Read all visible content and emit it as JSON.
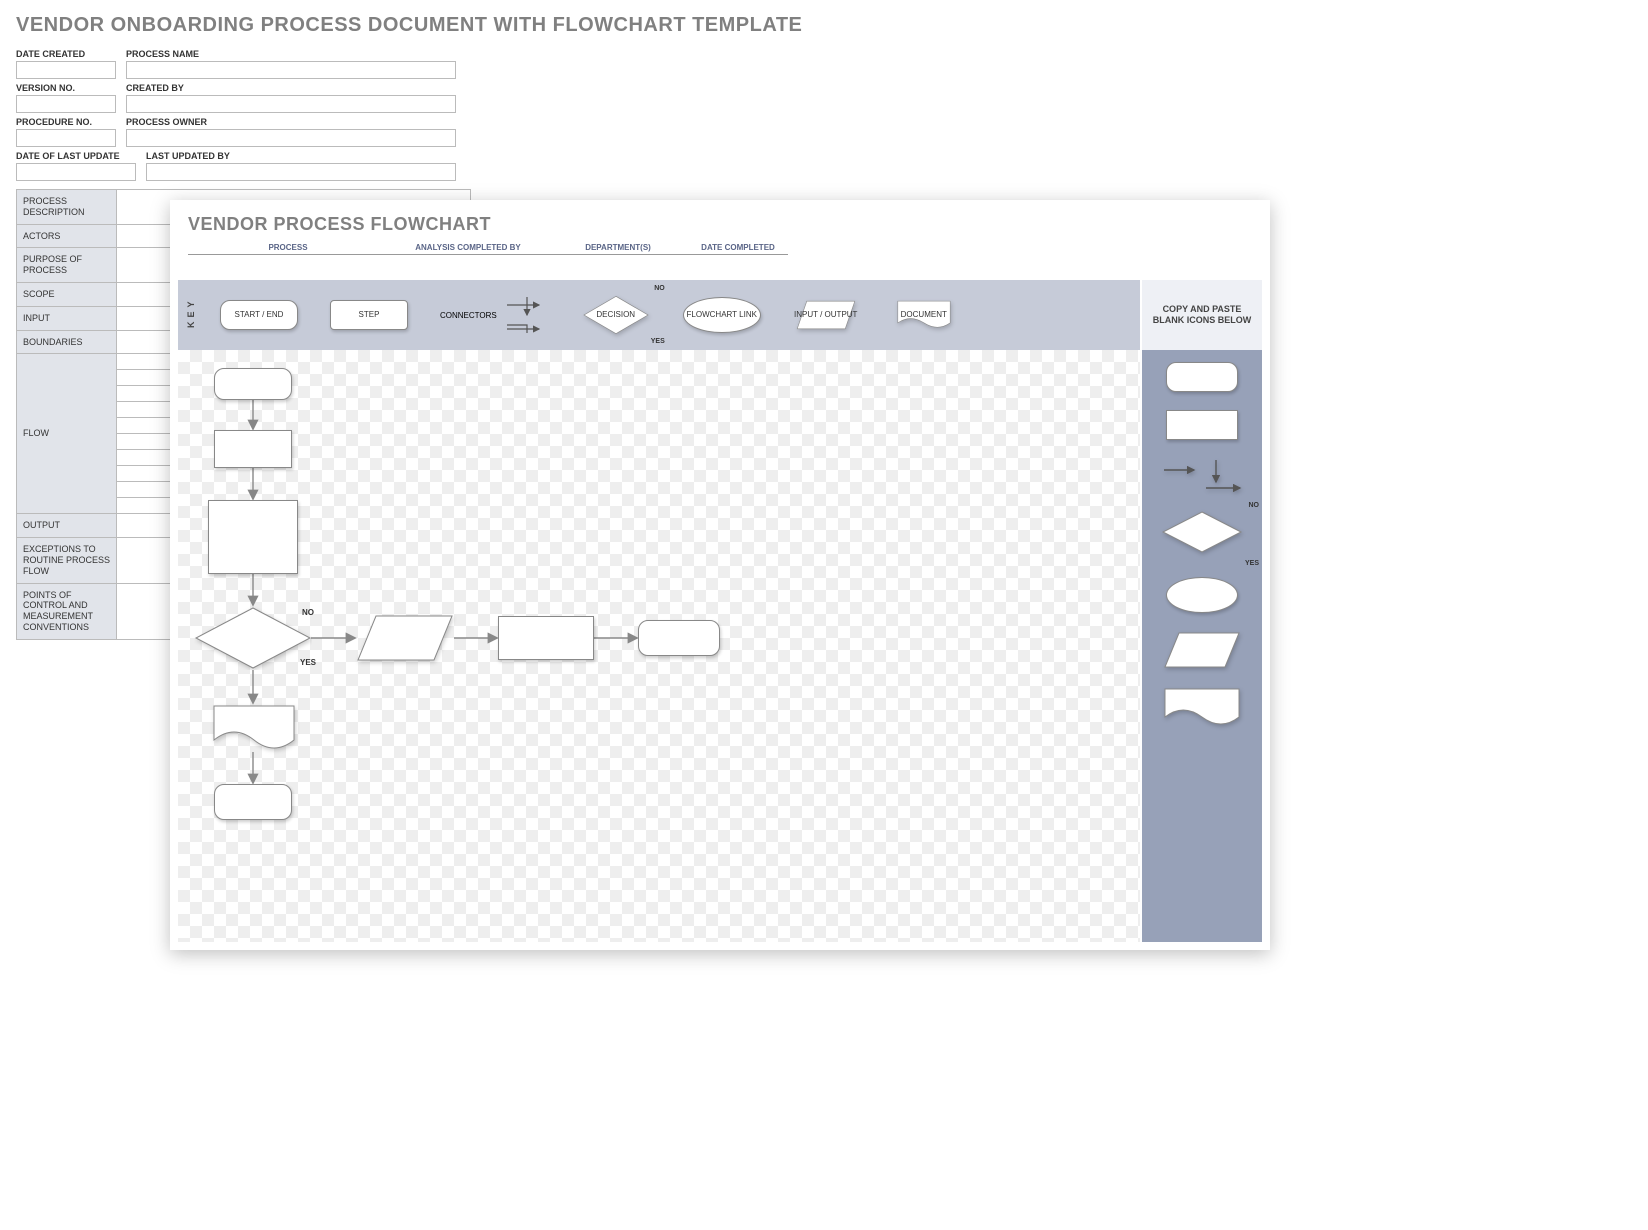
{
  "doc": {
    "title": "VENDOR ONBOARDING  PROCESS DOCUMENT  WITH FLOWCHART TEMPLATE",
    "fields": {
      "date_created": "DATE CREATED",
      "process_name": "PROCESS NAME",
      "version_no": "VERSION NO.",
      "created_by": "CREATED BY",
      "procedure_no": "PROCEDURE NO.",
      "process_owner": "PROCESS OWNER",
      "date_last_update": "DATE OF LAST UPDATE",
      "last_updated_by": "LAST UPDATED BY"
    },
    "rows": {
      "process_description": "PROCESS DESCRIPTION",
      "actors": "ACTORS",
      "purpose": "PURPOSE OF PROCESS",
      "scope": "SCOPE",
      "input": "INPUT",
      "boundaries": "BOUNDARIES",
      "flow": "FLOW",
      "output": "OUTPUT",
      "exceptions": "EXCEPTIONS TO ROUTINE PROCESS FLOW",
      "points": "POINTS OF CONTROL AND MEASUREMENT CONVENTIONS"
    }
  },
  "panel": {
    "title": "VENDOR PROCESS FLOWCHART",
    "header": {
      "process": "PROCESS",
      "analysis": "ANALYSIS COMPLETED BY",
      "departments": "DEPARTMENT(S)",
      "date_completed": "DATE COMPLETED"
    },
    "key": {
      "label": "KEY",
      "start_end": "START / END",
      "step": "STEP",
      "connectors": "CONNECTORS",
      "decision": "DECISION",
      "no": "NO",
      "yes": "YES",
      "link": "FLOWCHART LINK",
      "io": "INPUT / OUTPUT",
      "document": "DOCUMENT"
    },
    "palette_head": "COPY AND PASTE BLANK ICONS BELOW",
    "canvas_labels": {
      "no": "NO",
      "yes": "YES"
    }
  }
}
